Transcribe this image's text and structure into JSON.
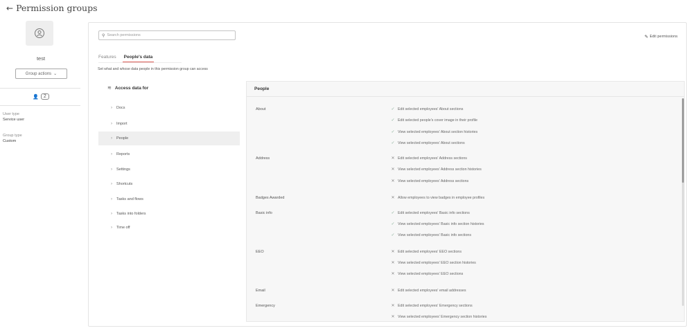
{
  "header": {
    "back_label": "Permission groups"
  },
  "group": {
    "name": "test",
    "actions_label": "Group actions",
    "member_count": "2",
    "user_type_label": "User type",
    "user_type_value": "Service user",
    "group_type_label": "Group type",
    "group_type_value": "Custom"
  },
  "search": {
    "placeholder": "Search permissions"
  },
  "edit_permissions_label": "Edit permissions",
  "tabs": [
    {
      "label": "Features",
      "active": false
    },
    {
      "label": "People's data",
      "active": true
    }
  ],
  "description": "Set what and whose data people in this permission group can access",
  "access_panel": {
    "title": "Access data for",
    "items": [
      {
        "label": "Docs",
        "selected": false
      },
      {
        "label": "Import",
        "selected": false
      },
      {
        "label": "People",
        "selected": true
      },
      {
        "label": "Reports",
        "selected": false
      },
      {
        "label": "Settings",
        "selected": false
      },
      {
        "label": "Shortcuts",
        "selected": false
      },
      {
        "label": "Tasks and flows",
        "selected": false
      },
      {
        "label": "Tasks into folders",
        "selected": false
      },
      {
        "label": "Time off",
        "selected": false
      }
    ]
  },
  "people_panel": {
    "title": "People",
    "sections": [
      {
        "name": "About",
        "perms": [
          {
            "allowed": true,
            "text": "Edit selected employees' About sections"
          },
          {
            "allowed": true,
            "text": "Edit selected people's cover image in their profile"
          },
          {
            "allowed": true,
            "text": "View selected employees' About section histories"
          },
          {
            "allowed": true,
            "text": "View selected employees' About sections"
          }
        ]
      },
      {
        "name": "Address",
        "perms": [
          {
            "allowed": false,
            "text": "Edit selected employees' Address sections"
          },
          {
            "allowed": false,
            "text": "View selected employees' Address section histories"
          },
          {
            "allowed": false,
            "text": "View selected employees' Address sections"
          }
        ]
      },
      {
        "name": "Badges Awarded",
        "perms": [
          {
            "allowed": false,
            "text": "Allow employees to view badges in employee profiles"
          }
        ]
      },
      {
        "name": "Basic info",
        "perms": [
          {
            "allowed": true,
            "text": "Edit selected employees' Basic info sections"
          },
          {
            "allowed": true,
            "text": "View selected employees' Basic info section histories"
          },
          {
            "allowed": true,
            "text": "View selected employees' Basic info sections"
          }
        ]
      },
      {
        "name": "EEO",
        "perms": [
          {
            "allowed": false,
            "text": "Edit selected employees' EEO sections"
          },
          {
            "allowed": false,
            "text": "View selected employees' EEO section histories"
          },
          {
            "allowed": false,
            "text": "View selected employees' EEO sections"
          }
        ]
      },
      {
        "name": "Email",
        "perms": [
          {
            "allowed": false,
            "text": "Edit selected employees' email addresses"
          }
        ]
      },
      {
        "name": "Emergency",
        "perms": [
          {
            "allowed": false,
            "text": "Edit selected employees' Emergency sections"
          },
          {
            "allowed": false,
            "text": "View selected employees' Emergency section histories"
          }
        ]
      }
    ]
  },
  "colors": {
    "accent": "#d9554f",
    "allowed_mark": "#8ab09a",
    "panel_bg": "#f7f7f7"
  }
}
